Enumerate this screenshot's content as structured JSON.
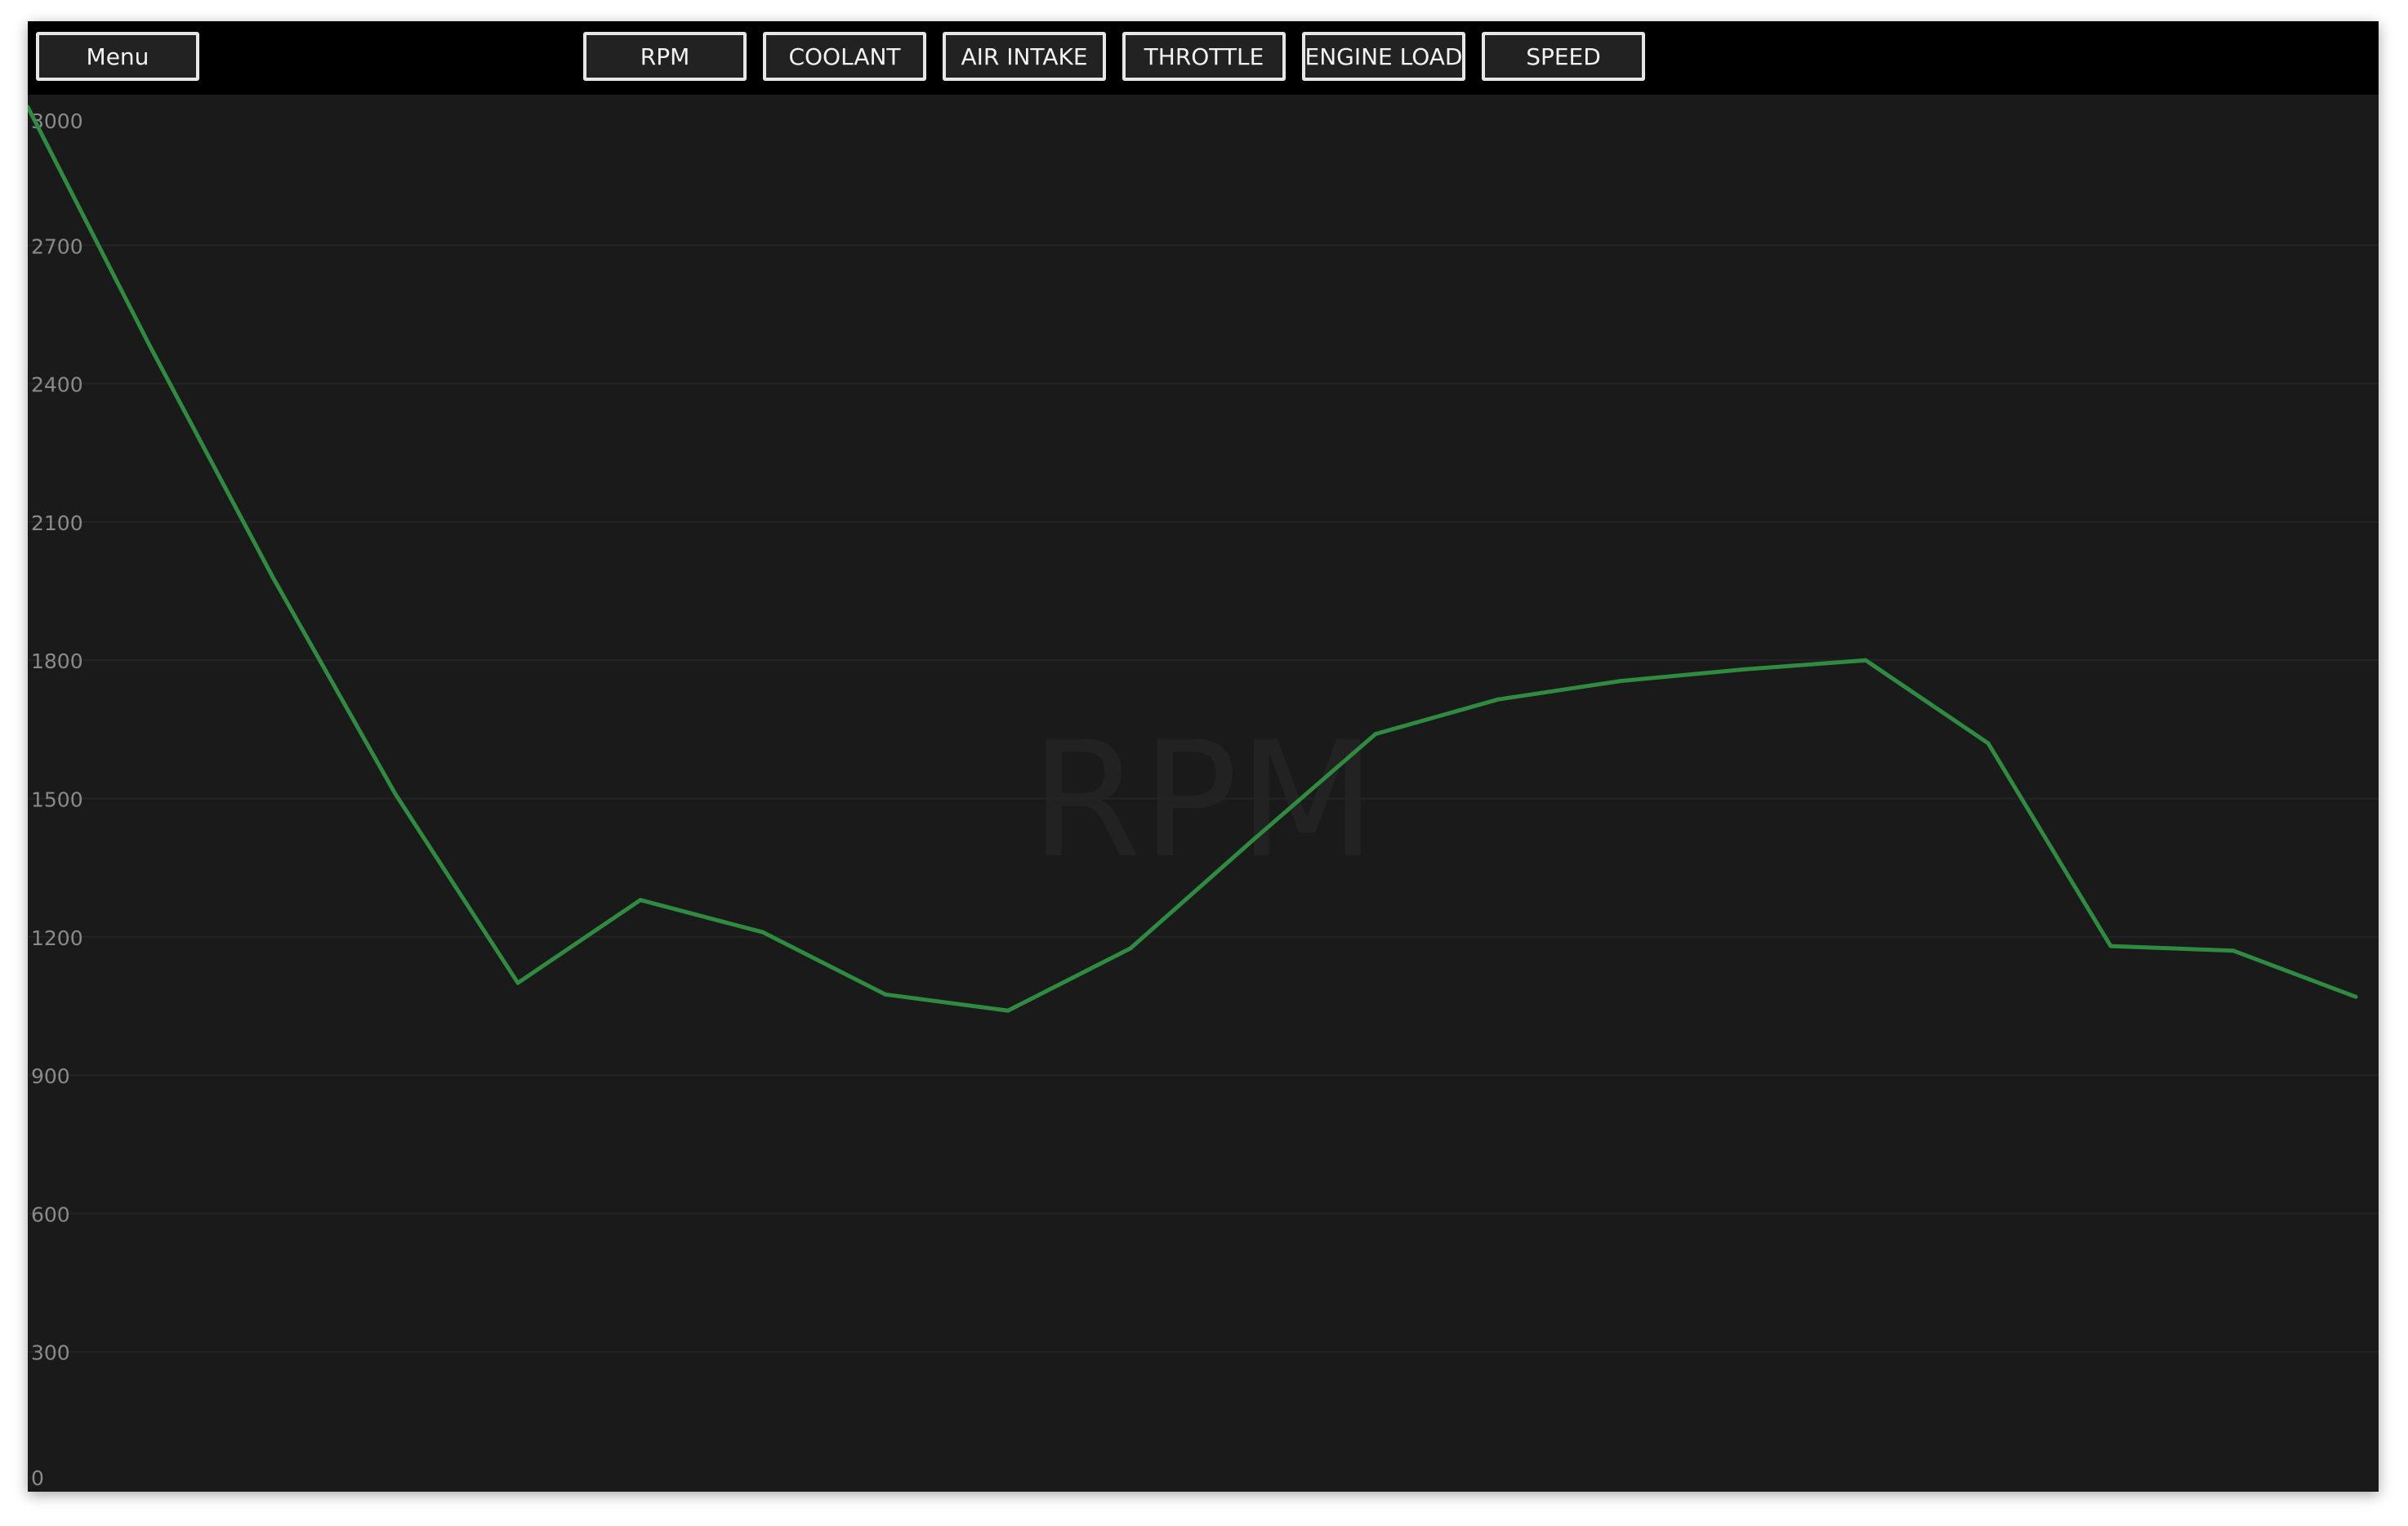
{
  "toolbar": {
    "menu_label": "Menu",
    "tabs": [
      {
        "label": "RPM"
      },
      {
        "label": "COOLANT"
      },
      {
        "label": "AIR INTAKE"
      },
      {
        "label": "THROTTLE"
      },
      {
        "label": "ENGINE LOAD"
      },
      {
        "label": "SPEED"
      }
    ]
  },
  "chart": {
    "watermark": "RPM"
  },
  "colors": {
    "background": "#1a1a1a",
    "toolbar": "#000000",
    "line": "#2e8b40",
    "tick_text": "#8a8a8a",
    "grid": "#242424"
  },
  "chart_data": {
    "type": "line",
    "title": "RPM",
    "xlabel": "",
    "ylabel": "",
    "ylim": [
      0,
      3000
    ],
    "yticks": [
      0,
      300,
      600,
      900,
      1200,
      1500,
      1800,
      2100,
      2400,
      2700,
      3000
    ],
    "grid": true,
    "legend": "none",
    "series": [
      {
        "values": [
          3000,
          2480,
          1980,
          1510,
          1100,
          1280,
          1210,
          1075,
          1040,
          1175,
          1410,
          1640,
          1715,
          1755,
          1780,
          1800,
          1620,
          1180,
          1170,
          1070
        ]
      }
    ]
  }
}
